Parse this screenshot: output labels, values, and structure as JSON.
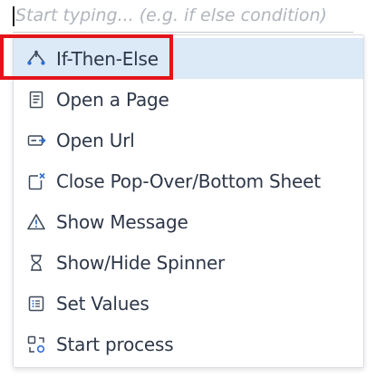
{
  "search": {
    "placeholder": "Start typing... (e.g. if else condition)",
    "value": ""
  },
  "menu": {
    "items": [
      {
        "label": "If-Then-Else",
        "icon": "branch-icon",
        "selected": true
      },
      {
        "label": "Open a Page",
        "icon": "page-icon",
        "selected": false
      },
      {
        "label": "Open Url",
        "icon": "url-icon",
        "selected": false
      },
      {
        "label": "Close Pop-Over/Bottom Sheet",
        "icon": "close-popover-icon",
        "selected": false
      },
      {
        "label": "Show Message",
        "icon": "warning-icon",
        "selected": false
      },
      {
        "label": "Show/Hide Spinner",
        "icon": "hourglass-icon",
        "selected": false
      },
      {
        "label": "Set Values",
        "icon": "list-icon",
        "selected": false
      },
      {
        "label": "Start process",
        "icon": "process-icon",
        "selected": false
      }
    ]
  },
  "colors": {
    "selected_background": "#dce9f7",
    "highlight_border": "#e4141b",
    "text": "#2d3748",
    "icon": "#3f4a5a",
    "accent": "#2f6fd1",
    "placeholder": "#b0b5bc"
  }
}
